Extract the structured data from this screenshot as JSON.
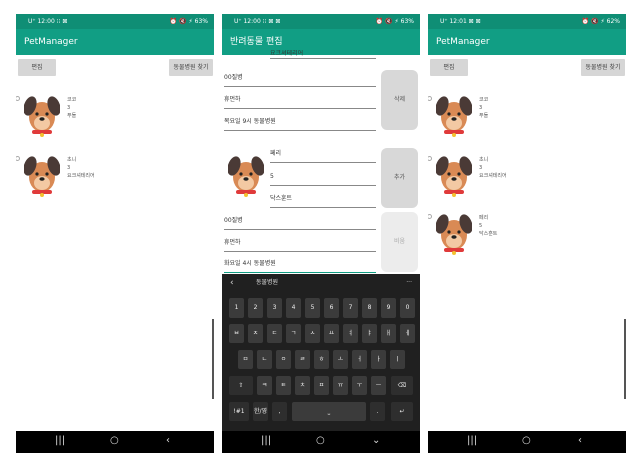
{
  "screens": [
    {
      "status": {
        "left": "U⁺ 12:00 ⁝⁝ ⊠",
        "right": "⏰ 🔇 ⚡ 63%"
      },
      "appbar_title": "PetManager",
      "edit_button": "편집",
      "find_hospital_button": "동물병원 찾기",
      "pets": [
        {
          "name": "코코",
          "age": "3",
          "breed": "푸들"
        },
        {
          "name": "초니",
          "age": "3",
          "breed": "요크셔테리어"
        }
      ]
    },
    {
      "status": {
        "left": "U⁺ 12:00 ⁝⁝ ⊠ ⊠",
        "right": "⏰ 🔇 ⚡ 63%"
      },
      "appbar_title": "반려동물 편집",
      "top_cut_text": "요크셔테리어",
      "first_form": {
        "hospital": "00질병",
        "phone": "휴먼하",
        "address": "목요일 9시 동물병원"
      },
      "delete_button": "삭제",
      "second_form": {
        "name": "페리",
        "age": "5",
        "breed": "닥스훈트",
        "hospital": "00질병",
        "phone": "휴먼하",
        "address": "화요일 4시 동물병원"
      },
      "add_button": "추가",
      "clear_button": "비움",
      "keyboard": {
        "toolbar_text": "동물병원",
        "num_row": [
          "1",
          "2",
          "3",
          "4",
          "5",
          "6",
          "7",
          "8",
          "9",
          "0"
        ],
        "row1": [
          "ㅂ",
          "ㅈ",
          "ㄷ",
          "ㄱ",
          "ㅅ",
          "ㅛ",
          "ㅕ",
          "ㅑ",
          "ㅐ",
          "ㅔ"
        ],
        "row2": [
          "ㅁ",
          "ㄴ",
          "ㅇ",
          "ㄹ",
          "ㅎ",
          "ㅗ",
          "ㅓ",
          "ㅏ",
          "ㅣ"
        ],
        "row3": [
          "ㅋ",
          "ㅌ",
          "ㅊ",
          "ㅍ",
          "ㅠ",
          "ㅜ",
          "ㅡ"
        ],
        "sym_key": "!#1",
        "lang_key": "한/영",
        "comma_key": ",",
        "period_key": "."
      }
    },
    {
      "status": {
        "left": "U⁺ 12:01 ⊠ ⊠",
        "right": "⏰ 🔇 ⚡ 62%"
      },
      "appbar_title": "PetManager",
      "edit_button": "편집",
      "find_hospital_button": "동물병원 찾기",
      "pets": [
        {
          "name": "코코",
          "age": "3",
          "breed": "푸들"
        },
        {
          "name": "초니",
          "age": "3",
          "breed": "요크셔테리어"
        },
        {
          "name": "페리",
          "age": "5",
          "breed": "닥스훈트"
        }
      ]
    }
  ],
  "colors": {
    "primary": "#119e84",
    "primary_dark": "#0f8e75",
    "button": "#d6d6d6"
  }
}
